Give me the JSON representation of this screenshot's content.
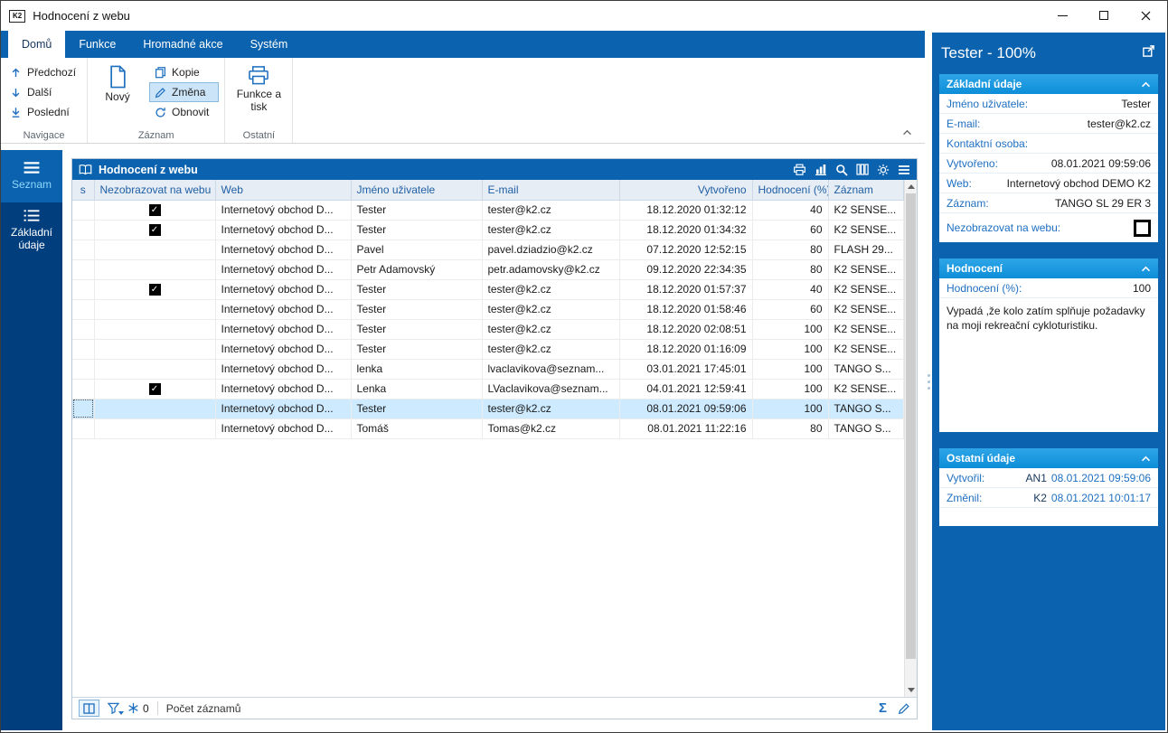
{
  "window": {
    "title": "Hodnocení z webu",
    "app_icon": "K2"
  },
  "ribbon": {
    "tabs": [
      {
        "label": "Domů",
        "active": true
      },
      {
        "label": "Funkce",
        "active": false
      },
      {
        "label": "Hromadné akce",
        "active": false
      },
      {
        "label": "Systém",
        "active": false
      }
    ],
    "nav_group": {
      "label": "Navigace",
      "items": [
        {
          "label": "Předchozí"
        },
        {
          "label": "Další"
        },
        {
          "label": "Poslední"
        }
      ]
    },
    "record_group": {
      "label": "Záznam",
      "new_label": "Nový",
      "items": [
        {
          "label": "Kopie",
          "active": false
        },
        {
          "label": "Změna",
          "active": true
        },
        {
          "label": "Obnovit",
          "active": false
        }
      ]
    },
    "other_group": {
      "label": "Ostatní",
      "print_label": "Funkce a tisk"
    }
  },
  "sidebar": {
    "items": [
      {
        "label": "Seznam",
        "active": true
      },
      {
        "label": "Základní údaje",
        "active": false
      }
    ]
  },
  "grid": {
    "title": "Hodnocení z webu",
    "columns": [
      "s",
      "Nezobrazovat na webu",
      "Web",
      "Jméno uživatele",
      "E-mail",
      "Vytvořeno",
      "Hodnocení (%)",
      "Záznam"
    ],
    "rows": [
      {
        "checked": true,
        "selected": false,
        "web": "Internetový obchod D...",
        "user": "Tester",
        "email": "tester@k2.cz",
        "created": "18.12.2020 01:32:12",
        "rating": "40",
        "record": "K2 SENSE..."
      },
      {
        "checked": true,
        "selected": false,
        "web": "Internetový obchod D...",
        "user": "Tester",
        "email": "tester@k2.cz",
        "created": "18.12.2020 01:34:32",
        "rating": "60",
        "record": "K2 SENSE..."
      },
      {
        "checked": false,
        "selected": false,
        "web": "Internetový obchod D...",
        "user": "Pavel",
        "email": "pavel.dziadzio@k2.cz",
        "created": "07.12.2020 12:52:15",
        "rating": "80",
        "record": "FLASH 29..."
      },
      {
        "checked": false,
        "selected": false,
        "web": "Internetový obchod D...",
        "user": "Petr Adamovský",
        "email": "petr.adamovsky@k2.cz",
        "created": "09.12.2020 22:34:35",
        "rating": "80",
        "record": "K2 SENSE..."
      },
      {
        "checked": true,
        "selected": false,
        "web": "Internetový obchod D...",
        "user": "Tester",
        "email": "tester@k2.cz",
        "created": "18.12.2020 01:57:37",
        "rating": "40",
        "record": "K2 SENSE..."
      },
      {
        "checked": false,
        "selected": false,
        "web": "Internetový obchod D...",
        "user": "Tester",
        "email": "tester@k2.cz",
        "created": "18.12.2020 01:58:46",
        "rating": "60",
        "record": "K2 SENSE..."
      },
      {
        "checked": false,
        "selected": false,
        "web": "Internetový obchod D...",
        "user": "Tester",
        "email": "tester@k2.cz",
        "created": "18.12.2020 02:08:51",
        "rating": "100",
        "record": "K2 SENSE..."
      },
      {
        "checked": false,
        "selected": false,
        "web": "Internetový obchod D...",
        "user": "Tester",
        "email": "tester@k2.cz",
        "created": "18.12.2020 01:16:09",
        "rating": "100",
        "record": "K2 SENSE..."
      },
      {
        "checked": false,
        "selected": false,
        "web": "Internetový obchod D...",
        "user": "lenka",
        "email": "lvaclavikova@seznam...",
        "created": "03.01.2021 17:45:01",
        "rating": "100",
        "record": "TANGO S..."
      },
      {
        "checked": true,
        "selected": false,
        "web": "Internetový obchod D...",
        "user": "Lenka",
        "email": "LVaclavikova@seznam...",
        "created": "04.01.2021 12:59:41",
        "rating": "100",
        "record": "K2 SENSE..."
      },
      {
        "checked": false,
        "selected": true,
        "web": "Internetový obchod D...",
        "user": "Tester",
        "email": "tester@k2.cz",
        "created": "08.01.2021 09:59:06",
        "rating": "100",
        "record": "TANGO S..."
      },
      {
        "checked": false,
        "selected": false,
        "web": "Internetový obchod D...",
        "user": "Tomáš",
        "email": "Tomas@k2.cz",
        "created": "08.01.2021 11:22:16",
        "rating": "80",
        "record": "TANGO S..."
      }
    ],
    "status": {
      "pinned_count": "0",
      "count_label": "Počet záznamů",
      "sum_symbol": "Σ"
    }
  },
  "detail": {
    "title": "Tester - 100%",
    "basic": {
      "header": "Základní údaje",
      "fields": [
        {
          "label": "Jméno uživatele:",
          "value": "Tester"
        },
        {
          "label": "E-mail:",
          "value": "tester@k2.cz"
        },
        {
          "label": "Kontaktní osoba:",
          "value": ""
        },
        {
          "label": "Vytvořeno:",
          "value": "08.01.2021 09:59:06"
        },
        {
          "label": "Web:",
          "value": "Internetový obchod DEMO K2"
        },
        {
          "label": "Záznam:",
          "value": "TANGO SL 29 ER 3"
        }
      ],
      "checkbox_label": "Nezobrazovat na webu:",
      "checkbox_checked": false
    },
    "rating": {
      "header": "Hodnocení",
      "label": "Hodnocení (%):",
      "value": "100",
      "note": "Vypadá ,že kolo zatím splňuje požadavky na moji rekreační cykloturistiku."
    },
    "other": {
      "header": "Ostatní údaje",
      "fields": [
        {
          "label": "Vytvořil:",
          "user": "AN1",
          "date": "08.01.2021 09:59:06"
        },
        {
          "label": "Změnil:",
          "user": "K2",
          "date": "08.01.2021 10:01:17"
        }
      ]
    }
  },
  "colors": {
    "ribbon_blue": "#0b63af",
    "sidebar_navy": "#003e7e",
    "section_header_blue": "#0d8ed8",
    "selected_row": "#cdeaff",
    "label_blue": "#1e6fc0"
  }
}
